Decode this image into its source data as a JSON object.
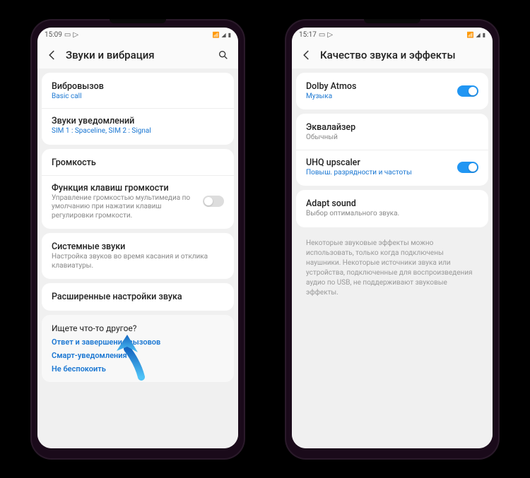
{
  "left": {
    "status_time": "15:09",
    "header_title": "Звуки и вибрация",
    "card1": {
      "row1": {
        "title": "Вибровызов",
        "sub": "Basic call"
      },
      "row2": {
        "title": "Звуки уведомлений",
        "sub": "SIM 1 : Spaceline, SIM 2 : Signal"
      }
    },
    "card2": {
      "row1": {
        "title": "Громкость"
      },
      "row2": {
        "title": "Функция клавиш громкости",
        "sub": "Управление громкостью мультимедиа по умолчанию при нажатии клавиш регулировки громкости."
      }
    },
    "card3": {
      "row1": {
        "title": "Системные звуки",
        "sub": "Настройка звуков во время касания и отклика клавиатуры."
      }
    },
    "card4": {
      "row1": {
        "title": "Расширенные настройки звука"
      }
    },
    "footer": {
      "title": "Ищете что-то другое?",
      "link1": "Ответ и завершение вызовов",
      "link2": "Смарт-уведомления",
      "link3": "Не беспокоить"
    }
  },
  "right": {
    "status_time": "15:17",
    "header_title": "Качество звука и эффекты",
    "card1": {
      "row1": {
        "title": "Dolby Atmos",
        "sub": "Музыка"
      }
    },
    "card2": {
      "row1": {
        "title": "Эквалайзер",
        "sub": "Обычный"
      },
      "row2": {
        "title": "UHQ upscaler",
        "sub": "Повыш. разрядности и частоты"
      }
    },
    "card3": {
      "row1": {
        "title": "Adapt sound",
        "sub": "Выбор оптимального звука."
      }
    },
    "note": "Некоторые звуковые эффекты можно использовать, только когда подключены наушники. Некоторые источники звука или устройства, подключенные для воспроизведения аудио по USB, не поддерживают звуковые эффекты."
  }
}
